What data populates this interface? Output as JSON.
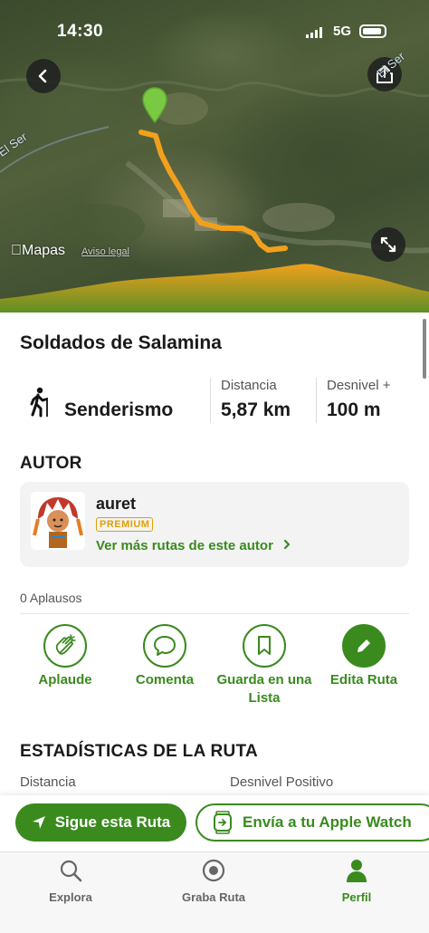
{
  "status_bar": {
    "time": "14:30",
    "network": "5G"
  },
  "map": {
    "apple_maps_label": "Mapas",
    "legal_notice": "Aviso legal",
    "river_label": "El Ser"
  },
  "route": {
    "title": "Soldados de Salamina",
    "activity": "Senderismo",
    "distance_label": "Distancia",
    "distance_value": "5,87 km",
    "elevation_label": "Desnivel +",
    "elevation_value": "100 m"
  },
  "author_section": {
    "title": "AUTOR",
    "name": "auret",
    "badge": "PREMIUM",
    "more_routes": "Ver más rutas de este autor"
  },
  "claps": "0 Aplausos",
  "actions": [
    {
      "label": "Aplaude",
      "icon": "clap-icon"
    },
    {
      "label": "Comenta",
      "icon": "comment-icon"
    },
    {
      "label": "Guarda en una Lista",
      "icon": "bookmark-icon"
    },
    {
      "label": "Edita Ruta",
      "icon": "pencil-icon"
    }
  ],
  "stats_section": {
    "title": "ESTADÍSTICAS DE LA RUTA",
    "col1_label": "Distancia",
    "col2_label": "Desnivel Positivo"
  },
  "bottom_buttons": {
    "follow": "Sigue esta Ruta",
    "watch": "Envía a tu Apple Watch"
  },
  "tabs": [
    {
      "label": "Explora",
      "icon": "search-icon"
    },
    {
      "label": "Graba Ruta",
      "icon": "record-icon"
    },
    {
      "label": "Perfil",
      "icon": "person-icon",
      "active": true
    }
  ],
  "colors": {
    "accent": "#3a8a1e",
    "route": "#f2a01c",
    "premium": "#e0a100"
  }
}
